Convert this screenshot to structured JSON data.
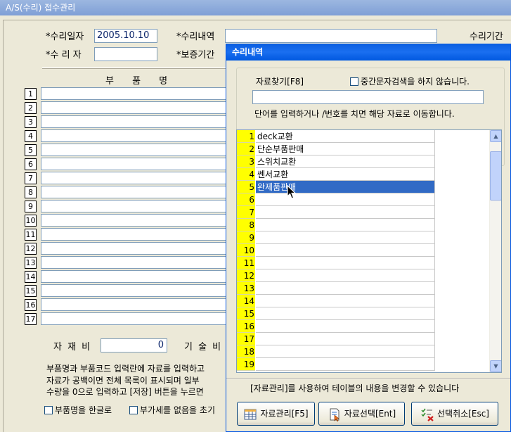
{
  "window": {
    "title": "A/S(수리) 접수관리"
  },
  "form": {
    "repair_date_label": "*수리일자",
    "repair_date_value": "2005.10.10",
    "repair_detail_label": "*수리내역",
    "repair_period_label": "수리기간",
    "repairer_label": "*수 리 자",
    "warranty_label": "*보증기간",
    "parts_header": "부 품 명",
    "row_numbers": [
      "1",
      "2",
      "3",
      "4",
      "5",
      "6",
      "7",
      "8",
      "9",
      "10",
      "11",
      "12",
      "13",
      "14",
      "15",
      "16",
      "17"
    ],
    "material_cost_label": "자 재 비",
    "material_cost_value": "0",
    "labor_label": "기 술 비",
    "notes": [
      "부품명과 부품코드 입력란에 자료를 입력하고",
      "자료가 공백이면 전체 목록이 표시되며 일부",
      "수량을 0으로 입력하고 [저장] 버튼을 누르면"
    ],
    "checkbox_korean": "부품명을 한글로",
    "checkbox_vat": "부가세를 없음을 초기"
  },
  "dialog": {
    "title": "수리내역",
    "search_label": "자료찾기[F8]",
    "middle_search_checkbox": "중간문자검색을 하지 않습니다.",
    "search_value": "",
    "hint": "단어를 입력하거나  /번호를 치면 해당 자료로 이동합니다.",
    "rows": [
      {
        "num": "1",
        "name": "deck교환"
      },
      {
        "num": "2",
        "name": "단순부품판매"
      },
      {
        "num": "3",
        "name": "스위치교환"
      },
      {
        "num": "4",
        "name": "쎈서교환"
      },
      {
        "num": "5",
        "name": "완제품판매"
      },
      {
        "num": "6",
        "name": ""
      },
      {
        "num": "7",
        "name": ""
      },
      {
        "num": "8",
        "name": ""
      },
      {
        "num": "9",
        "name": ""
      },
      {
        "num": "10",
        "name": ""
      },
      {
        "num": "11",
        "name": ""
      },
      {
        "num": "12",
        "name": ""
      },
      {
        "num": "13",
        "name": ""
      },
      {
        "num": "14",
        "name": ""
      },
      {
        "num": "15",
        "name": ""
      },
      {
        "num": "16",
        "name": ""
      },
      {
        "num": "17",
        "name": ""
      },
      {
        "num": "18",
        "name": ""
      },
      {
        "num": "19",
        "name": ""
      }
    ],
    "selected_index": 4,
    "footer_text": "[자료관리]를 사용하여 테이블의 내용을 변경할 수 있습니다",
    "btn_manage": "자료관리[F5]",
    "btn_select": "자료선택[Ent]",
    "btn_cancel": "선택취소[Esc]",
    "colors": {
      "num_bg": "#ffff00",
      "selection": "#316ac5"
    }
  }
}
